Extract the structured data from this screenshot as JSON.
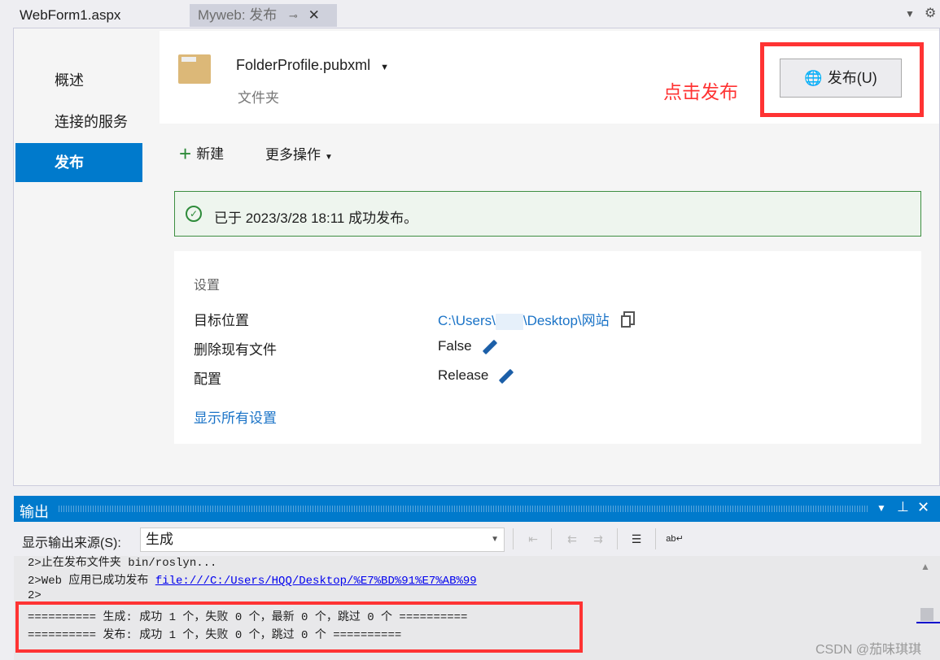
{
  "tabs": [
    {
      "label": "WebForm1.aspx"
    },
    {
      "label": "Myweb: 发布"
    }
  ],
  "nav": {
    "items": [
      {
        "label": "概述"
      },
      {
        "label": "连接的服务"
      },
      {
        "label": "发布"
      }
    ]
  },
  "profile": {
    "name": "FolderProfile.pubxml",
    "type": "文件夹"
  },
  "annotation": "点击发布",
  "publish_button": "发布(U)",
  "actions": {
    "new": "新建",
    "more": "更多操作"
  },
  "status": "已于 2023/3/28 18:11 成功发布。",
  "settings": {
    "title": "设置",
    "rows": [
      {
        "label": "目标位置",
        "value_prefix": "C:\\Users\\",
        "value_suffix": "\\Desktop\\网站"
      },
      {
        "label": "删除现有文件",
        "value": "False"
      },
      {
        "label": "配置",
        "value": "Release"
      }
    ],
    "show_all": "显示所有设置"
  },
  "output": {
    "title": "输出",
    "source_label": "显示输出来源(S):",
    "source_value": "生成",
    "lines": [
      "2>止在发布文件夹 bin/roslyn...",
      "2>Web 应用已成功发布 ",
      "2>",
      "========== 生成: 成功 1 个，失败 0 个，最新 0 个，跳过 0 个 ==========",
      "========== 发布: 成功 1 个，失败 0 个，跳过 0 个 =========="
    ],
    "link": "file:///C:/Users/HQQ/Desktop/%E7%BD%91%E7%AB%99"
  },
  "watermark": "CSDN @茄味琪琪",
  "colors": {
    "accent": "#007acc",
    "highlight": "#ff3333",
    "success": "#2e8b3a",
    "link": "#1a73c7"
  }
}
